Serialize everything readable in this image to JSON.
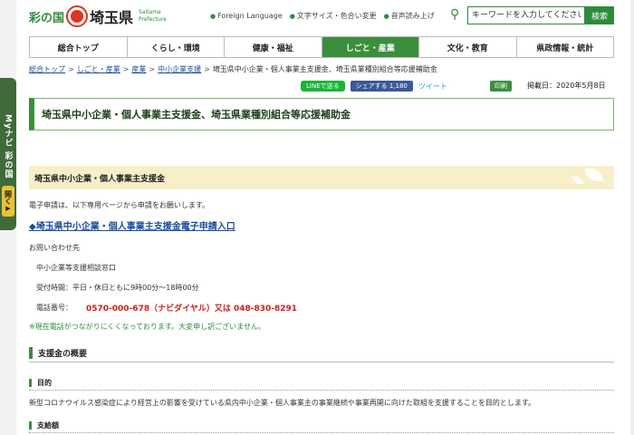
{
  "header": {
    "logo_ayanokuni": "彩の国",
    "logo_pref": "埼玉県",
    "logo_en_1": "Saitama",
    "logo_en_2": "Prefecture",
    "util_links": [
      "Foreign Language",
      "文字サイズ・色合い変更",
      "音声読み上げ"
    ],
    "search_placeholder": "キーワードを入力してください",
    "search_button": "検索"
  },
  "side": {
    "mynavi_label": "Myナビ 彩の国",
    "open_label": "開く",
    "open_arrow": "▶"
  },
  "nav": {
    "items": [
      "総合トップ",
      "くらし・環境",
      "健康・福祉",
      "しごと・産業",
      "文化・教育",
      "県政情報・統計"
    ],
    "active_index": 3
  },
  "breadcrumb": {
    "items": [
      "総合トップ",
      "しごと・産業",
      "産業",
      "中小企業支援"
    ],
    "current": "埼玉県中小企業・個人事業主支援金、埼玉県業種別組合等応援補助金"
  },
  "share": {
    "line": "LINEで送る",
    "facebook": "シェアする 1,180",
    "tweet": "ツイート",
    "print": "印刷",
    "published": "掲載日：2020年5月8日"
  },
  "title": "埼玉県中小企業・個人事業主支援金、埼玉県業種別組合等応援補助金",
  "section": {
    "heading": "埼玉県中小企業・個人事業主支援金",
    "intro": "電子申請は、以下専用ページから申請をお願いします。",
    "apply_link": "◆埼玉県中小企業・個人事業主支援金電子申請入口",
    "contact_label": "お問い合わせ先",
    "contact_office": "中小企業等支援相談窓口",
    "hours": "受付時間：平日・休日ともに9時00分～18時00分",
    "phone_label": "電話番号：",
    "phone_number": "0570-000-678（ナビダイヤル）又は 048-830-8291",
    "notice": "※現在電話がつながりにくくなっております。大変申し訳ございません。"
  },
  "overview": {
    "heading": "支援金の概要",
    "purpose_heading": "目的",
    "purpose_text": "新型コロナウイルス感染症により経営上の影響を受けている県内中小企業・個人事業主の事業継続や事業再開に向けた取組を支援することを目的とします。",
    "eligible_heading": "支給額"
  },
  "colors": {
    "brand_green": "#3b8f3c",
    "link_blue": "#1a4ea0",
    "alert_red": "#c8231f",
    "section_bg": "#f8efc9"
  }
}
